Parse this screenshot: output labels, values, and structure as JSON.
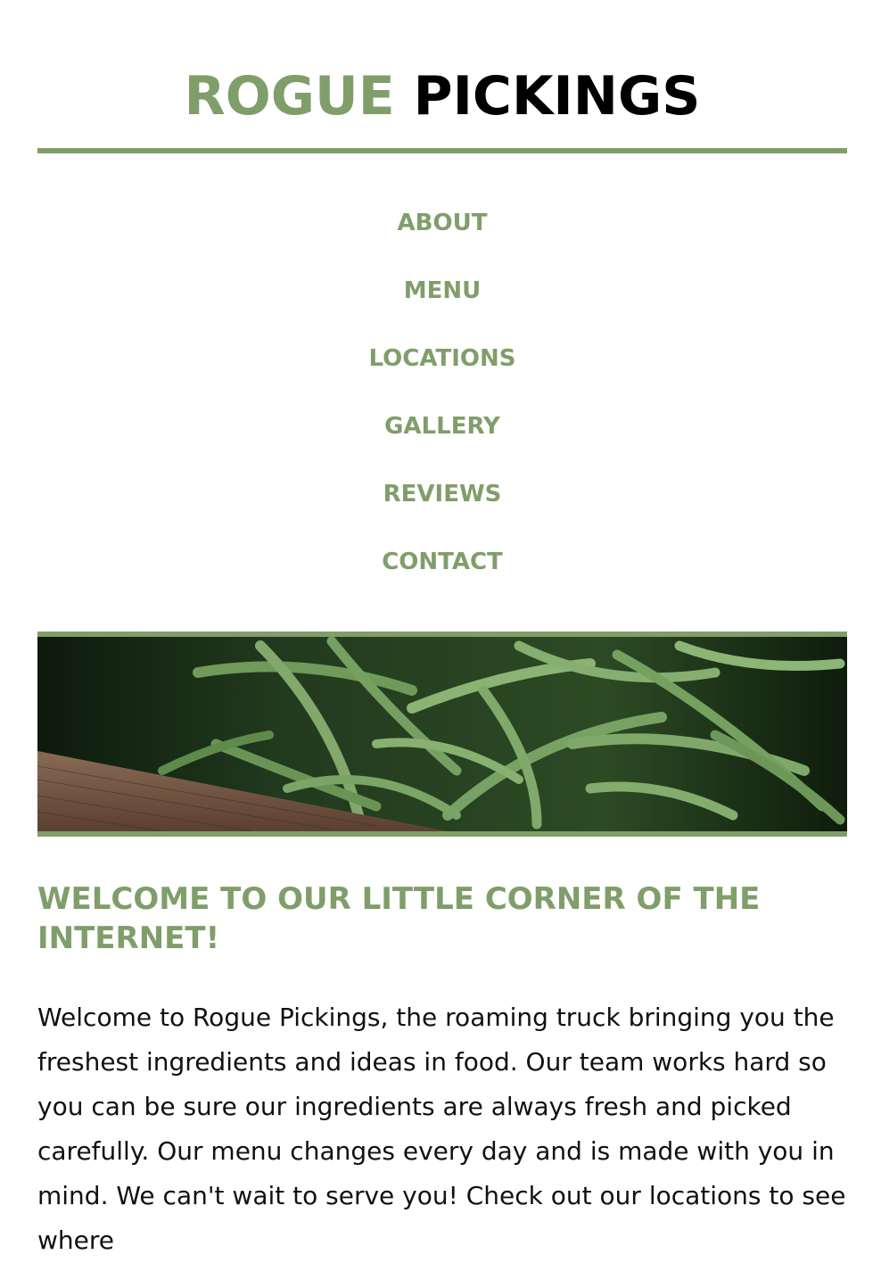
{
  "brand": {
    "name_part1": "ROGUE",
    "name_part2": "PICKINGS",
    "accent_color": "#809e6a",
    "text_color": "#000000"
  },
  "nav": {
    "items": [
      {
        "label": "ABOUT"
      },
      {
        "label": "MENU"
      },
      {
        "label": "LOCATIONS"
      },
      {
        "label": "GALLERY"
      },
      {
        "label": "REVIEWS"
      },
      {
        "label": "CONTACT"
      }
    ]
  },
  "hero": {
    "image_subject": "green-beans-in-wooden-crate"
  },
  "welcome": {
    "title": "WELCOME TO OUR LITTLE CORNER OF THE INTERNET!",
    "body": "Welcome to Rogue Pickings, the roaming truck bringing you the freshest ingredients and ideas in food. Our team works hard so you can be sure our ingredients are always fresh and picked carefully. Our menu changes every day and is made with you in mind. We can't wait to serve you! Check out our locations to see where"
  }
}
